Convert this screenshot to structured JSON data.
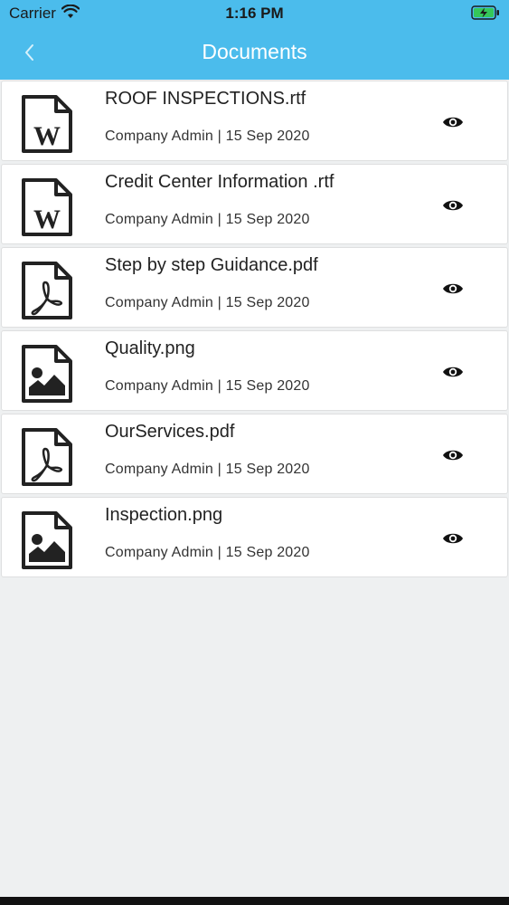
{
  "status_bar": {
    "carrier": "Carrier",
    "time": "1:16 PM",
    "wifi_icon": "wifi-icon",
    "battery_icon": "battery-charging-icon",
    "battery_color": "#35c759"
  },
  "nav": {
    "title": "Documents",
    "back_icon": "chevron-left-icon",
    "background": "#4bbcec"
  },
  "documents": [
    {
      "name": "ROOF INSPECTIONS.rtf",
      "meta": "Company Admin | 15 Sep 2020",
      "icon": "word-file-icon"
    },
    {
      "name": "Credit Center Information .rtf",
      "meta": "Company Admin | 15 Sep 2020",
      "icon": "word-file-icon"
    },
    {
      "name": "Step by step Guidance.pdf",
      "meta": "Company Admin | 15 Sep 2020",
      "icon": "pdf-file-icon"
    },
    {
      "name": "Quality.png",
      "meta": "Company Admin | 15 Sep 2020",
      "icon": "image-file-icon"
    },
    {
      "name": "OurServices.pdf",
      "meta": "Company Admin | 15 Sep 2020",
      "icon": "pdf-file-icon"
    },
    {
      "name": "Inspection.png",
      "meta": "Company Admin | 15 Sep 2020",
      "icon": "image-file-icon"
    }
  ],
  "view_icon": "eye-icon"
}
